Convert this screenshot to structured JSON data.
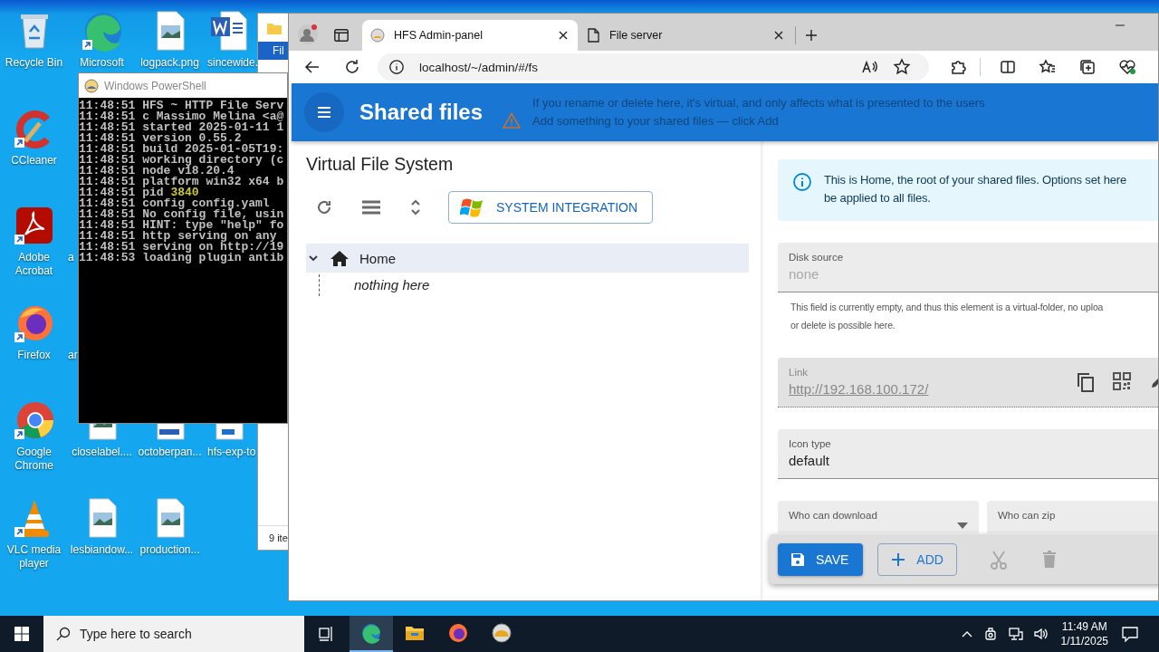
{
  "desktop": {
    "icons": [
      {
        "label": "Recycle Bin",
        "kind": "recycle-bin"
      },
      {
        "label": "Microsoft",
        "kind": "edge"
      },
      {
        "label": "logpack.png",
        "kind": "image-file"
      },
      {
        "label": "sincewide.",
        "kind": "word-file"
      },
      {
        "label": "CCleaner",
        "kind": "ccleaner"
      },
      {
        "label": "Adobe Acrobat",
        "kind": "acrobat"
      },
      {
        "label": "a",
        "kind": "covered"
      },
      {
        "label": "Firefox",
        "kind": "firefox"
      },
      {
        "label": "ar",
        "kind": "covered"
      },
      {
        "label": "Google Chrome",
        "kind": "chrome"
      },
      {
        "label": "closelabel....",
        "kind": "image-file"
      },
      {
        "label": "octoberpan...",
        "kind": "doc-file"
      },
      {
        "label": "hfs-exp-to",
        "kind": "blue-file"
      },
      {
        "label": "VLC media player",
        "kind": "vlc"
      },
      {
        "label": "lesbiandow...",
        "kind": "image-file"
      },
      {
        "label": "production...",
        "kind": "image-file"
      }
    ]
  },
  "explorer": {
    "tab": "Fil",
    "status": "9 ite"
  },
  "powershell": {
    "title": "Windows PowerShell",
    "lines": [
      {
        "text": "11:48:51 HFS ~ HTTP File Serv"
      },
      {
        "text": "11:48:51 c Massimo Melina <a@"
      },
      {
        "text": "11:48:51 started 2025-01-11 1"
      },
      {
        "text": "11:48:51 version 0.55.2"
      },
      {
        "text": "11:48:51 build 2025-01-05T19:"
      },
      {
        "text": "11:48:51 working directory (c"
      },
      {
        "text": "11:48:51 node v18.20.4"
      },
      {
        "text": "11:48:51 platform win32 x64 b"
      },
      {
        "text": "11:48:51 pid",
        "number": "3840"
      },
      {
        "text": "11:48:51 config config.yaml"
      },
      {
        "text": "11:48:51 No config file, usin"
      },
      {
        "text": "11:48:51 HINT: type \"help\" fo"
      },
      {
        "text": "11:48:51 http serving on any"
      },
      {
        "text": "11:48:51 serving on http://19"
      },
      {
        "text": "11:48:53 loading plugin antib"
      }
    ]
  },
  "browser": {
    "tabs": [
      {
        "title": "HFS Admin-panel",
        "kind": "hfs",
        "selected": true
      },
      {
        "title": "File server",
        "kind": "page",
        "selected": false
      }
    ],
    "address": "localhost/~/admin/#/fs",
    "page": {
      "header": {
        "title": "Shared files",
        "messages": [
          {
            "text": "If you rename or delete here, it's virtual, and only affects what is presented to the users",
            "kind": "note"
          },
          {
            "text": "Add something to your shared files — click Add",
            "kind": "warning"
          }
        ]
      },
      "vfs": {
        "title": "Virtual File System",
        "integration_button": "SYSTEM INTEGRATION",
        "tree": [
          {
            "label": "Home",
            "expanded": true,
            "selected": true,
            "children": [
              {
                "label": "nothing here",
                "kind": "empty"
              }
            ]
          }
        ]
      },
      "details": {
        "info_lines": [
          "This is Home, the root of your shared files. Options set here",
          "be applied to all files."
        ],
        "fields": [
          {
            "kind": "text",
            "label": "Disk source",
            "placeholder": "none",
            "helper_lines": [
              "This field is currently empty, and thus this element is a virtual-folder, no uploa",
              "or delete is possible here."
            ]
          },
          {
            "kind": "link",
            "label": "Link",
            "value": "http://192.168.100.172/"
          },
          {
            "kind": "select",
            "label": "Icon type",
            "value": "default"
          }
        ],
        "permissions": [
          {
            "label": "Who can download",
            "dropdown": true
          },
          {
            "label": "Who can zip"
          }
        ]
      },
      "actions": [
        {
          "kind": "primary",
          "label": "SAVE"
        },
        {
          "kind": "outlined",
          "label": "ADD"
        },
        {
          "kind": "cut",
          "disabled": true
        },
        {
          "kind": "delete",
          "disabled": true
        }
      ]
    }
  },
  "taskbar": {
    "search_placeholder": "Type here to search",
    "apps": [
      {
        "kind": "edge",
        "active": true
      },
      {
        "kind": "explorer",
        "active": false
      },
      {
        "kind": "firefox",
        "active": false
      },
      {
        "kind": "hfs",
        "active": false
      }
    ],
    "time": "11:49 AM",
    "date": "1/11/2025"
  }
}
